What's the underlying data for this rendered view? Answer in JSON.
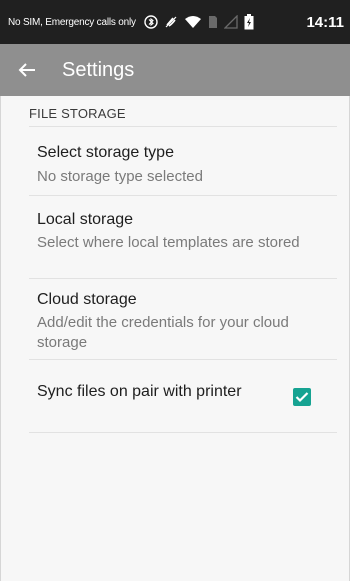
{
  "status_bar": {
    "carrier_text": "No SIM, Emergency calls only",
    "time": "14:11",
    "icons": [
      "bluetooth-icon",
      "mute-icon",
      "wifi-icon",
      "sim-icon",
      "signal-icon",
      "battery-icon"
    ]
  },
  "app_bar": {
    "back_icon": "arrow-left-icon",
    "title": "Settings"
  },
  "section": {
    "header": "FILE STORAGE"
  },
  "preferences": [
    {
      "title": "Select storage type",
      "summary": "No storage type selected"
    },
    {
      "title": "Local storage",
      "summary": "Select where local templates are stored"
    },
    {
      "title": "Cloud storage",
      "summary": "Add/edit the credentials for your cloud storage"
    }
  ],
  "sync": {
    "label": "Sync files on pair with printer",
    "checked": true,
    "accent_color": "#16a392"
  }
}
